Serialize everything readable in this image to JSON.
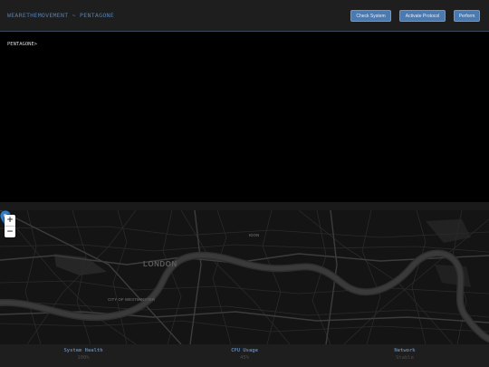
{
  "header": {
    "title": "WEARETHEMOVEMENT ~ PENTAGONE",
    "buttons": {
      "check_system": "Check System",
      "activate_protocol": "Activate Protocol",
      "perform": "Perform"
    }
  },
  "terminal": {
    "prompt": "PENTAGONE>",
    "input_value": ""
  },
  "map": {
    "labels": {
      "london": "LONDON",
      "westminster": "CITY OF WESTMINSTER",
      "district": "IDON"
    },
    "zoom_in": "+",
    "zoom_out": "−"
  },
  "status": {
    "system_health": {
      "label": "System Health",
      "value": "100%"
    },
    "cpu_usage": {
      "label": "CPU Usage",
      "value": "45%"
    },
    "network": {
      "label": "Network",
      "value": "Stable"
    }
  },
  "colors": {
    "accent": "#5a7fa8",
    "button": "#4a7ab0",
    "marker": "#2a81cb",
    "terminal_bg": "#000000"
  }
}
